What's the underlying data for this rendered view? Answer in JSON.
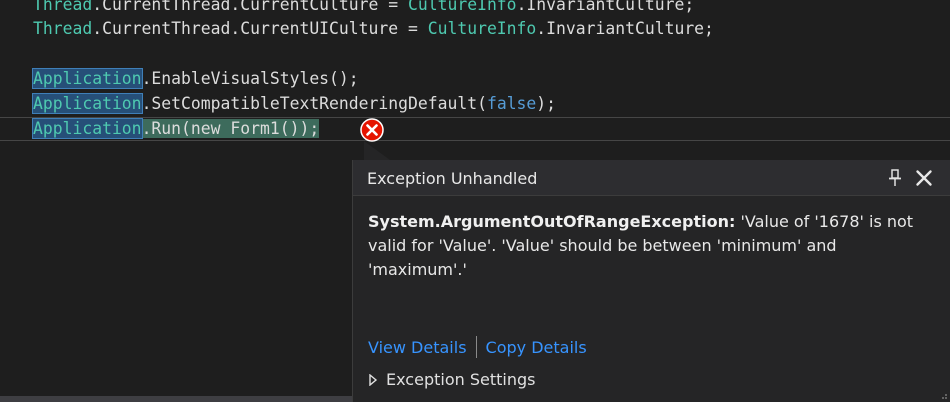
{
  "code": {
    "line0": {
      "a": "Thread",
      "b": ".CurrentThread.CurrentCulture = ",
      "c": "CultureInfo",
      "d": ".InvariantCulture;"
    },
    "line1": {
      "a": "Thread",
      "b": ".CurrentThread.CurrentUICulture = ",
      "c": "CultureInfo",
      "d": ".InvariantCulture;"
    },
    "line3": {
      "a": "Application",
      "b": ".EnableVisualStyles();"
    },
    "line4": {
      "a": "Application",
      "b": ".SetCompatibleTextRenderingDefault(",
      "c": "false",
      "d": ");"
    },
    "line5": {
      "a": "Application",
      "b": ".Run(new Form1());"
    }
  },
  "popup": {
    "title": "Exception Unhandled",
    "exception_type": "System.ArgumentOutOfRangeException:",
    "message": " 'Value of '1678' is not valid for 'Value'. 'Value' should be between 'minimum' and 'maximum'.'",
    "view_details": "View Details",
    "copy_details": "Copy Details",
    "exception_settings": "Exception Settings"
  },
  "colors": {
    "background": "#1e1e1e",
    "class_name": "#4ec9b0",
    "keyword": "#569cd6",
    "link": "#3794ff",
    "error": "#e51400"
  },
  "icons": [
    "error-icon",
    "pin-icon",
    "close-icon",
    "expand-caret-icon"
  ]
}
